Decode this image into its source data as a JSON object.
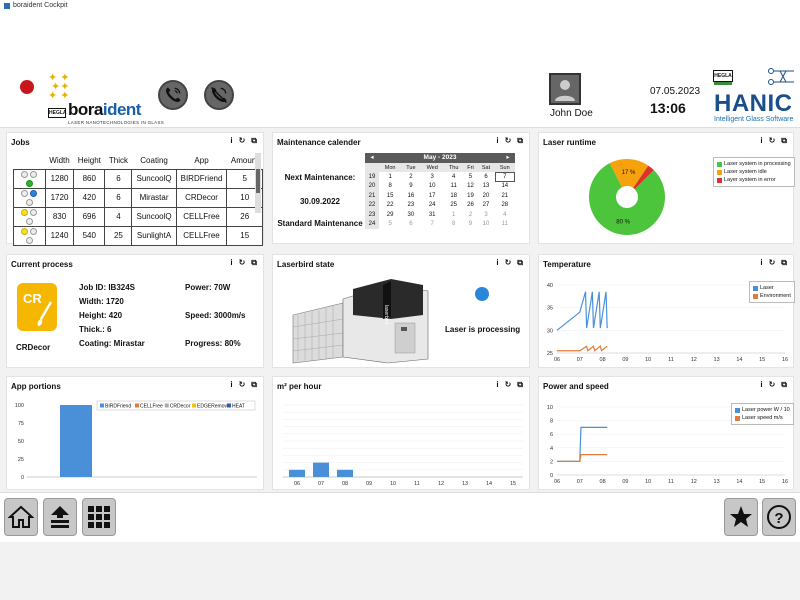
{
  "window": {
    "title": "boraident Cockpit"
  },
  "header": {
    "brand_left": "HEGLA",
    "brand_name_1": "bora",
    "brand_name_2": "ident",
    "brand_tagline": "LASER NANOTECHNOLOGIES IN GLASS",
    "user_name": "John Doe",
    "date": "07.05.2023",
    "time": "13:06",
    "brand_right_small": "HEGLA",
    "brand_right": "HANIC",
    "brand_right_tagline": "Intelligent Glass Software"
  },
  "panel_icons": {
    "info": "i",
    "refresh": "↻",
    "expand": "⧉"
  },
  "jobs": {
    "title": "Jobs",
    "columns": [
      "Width",
      "Height",
      "Thick",
      "Coating",
      "App",
      "Amount"
    ],
    "rows": [
      {
        "status": [
          "off",
          "off",
          "g"
        ],
        "width": "1280",
        "height": "860",
        "thick": "6",
        "coating": "SuncoolQ",
        "app": "BIRDFriend",
        "amount": "5"
      },
      {
        "status": [
          "off",
          "b",
          "off"
        ],
        "width": "1720",
        "height": "420",
        "thick": "6",
        "coating": "Mirastar",
        "app": "CRDecor",
        "amount": "10"
      },
      {
        "status": [
          "y",
          "off",
          "off"
        ],
        "width": "830",
        "height": "696",
        "thick": "4",
        "coating": "SuncoolQ",
        "app": "CELLFree",
        "amount": "26"
      },
      {
        "status": [
          "y",
          "off",
          "off"
        ],
        "width": "1240",
        "height": "540",
        "thick": "25",
        "coating": "SunlightA",
        "app": "CELLFree",
        "amount": "15"
      }
    ]
  },
  "maintenance": {
    "title": "Maintenance calender",
    "next_label": "Next Maintenance:",
    "next_date": "30.09.2022",
    "type": "Standard Maintenance",
    "calendar": {
      "month": "May - 2023",
      "prev": "◂",
      "next": "▸",
      "weekdays": [
        "Mon",
        "Tue",
        "Wed",
        "Thu",
        "Fri",
        "Sat",
        "Sun"
      ],
      "weeks": [
        {
          "wk": "19",
          "days": [
            "1",
            "2",
            "3",
            "4",
            "5",
            "6",
            "7"
          ]
        },
        {
          "wk": "20",
          "days": [
            "8",
            "9",
            "10",
            "11",
            "12",
            "13",
            "14"
          ]
        },
        {
          "wk": "21",
          "days": [
            "15",
            "16",
            "17",
            "18",
            "19",
            "20",
            "21"
          ]
        },
        {
          "wk": "22",
          "days": [
            "22",
            "23",
            "24",
            "25",
            "26",
            "27",
            "28"
          ]
        },
        {
          "wk": "23",
          "days": [
            "29",
            "30",
            "31",
            "1",
            "2",
            "3",
            "4"
          ]
        },
        {
          "wk": "24",
          "days": [
            "5",
            "6",
            "7",
            "8",
            "9",
            "10",
            "11"
          ]
        }
      ]
    }
  },
  "laser_runtime": {
    "title": "Laser runtime",
    "colors": {
      "processing": "#4cc43c",
      "idle": "#f5a20c",
      "error": "#d9342b"
    },
    "legend": [
      "Laser system in processing",
      "Laser system idle",
      "Layer system in error"
    ],
    "label_processing": "80 %",
    "label_idle": "17 %"
  },
  "current_process": {
    "title": "Current process",
    "icon_label": "CR",
    "app_name": "CRDecor",
    "job_id": "Job ID: IB324S",
    "width": "Width: 1720",
    "height": "Height: 420",
    "thick": "Thick.: 6",
    "coating": "Coating: Mirastar",
    "power": "Power: 70W",
    "speed": "Speed: 3000m/s",
    "progress": "Progress: 80%"
  },
  "laserbird": {
    "title": "Laserbird state",
    "machine_label": "laserbird",
    "status": "Laser is processing",
    "status_color": "#2a87d8"
  },
  "temperature": {
    "title": "Temperature",
    "legend": [
      "Laser",
      "Environment"
    ]
  },
  "app_portions": {
    "title": "App portions",
    "legend": [
      "BIRDFriend",
      "CELLFree",
      "CRDecor",
      "EDGERemove",
      "HEAT"
    ]
  },
  "m2_per_hour": {
    "title": "m² per hour"
  },
  "power_speed": {
    "title": "Power and speed",
    "legend": [
      "Laser power W / 10",
      "Laser speed m/s"
    ]
  },
  "chart_data": [
    {
      "type": "pie",
      "title": "Laser runtime",
      "categories": [
        "Laser system in processing",
        "Laser system idle",
        "Layer system in error"
      ],
      "values": [
        80,
        17,
        3
      ]
    },
    {
      "type": "line",
      "title": "Temperature",
      "xlim": [
        6,
        16
      ],
      "ylim": [
        25,
        40
      ],
      "x_ticks": [
        "06",
        "07",
        "08",
        "09",
        "10",
        "11",
        "12",
        "13",
        "14",
        "15",
        "16"
      ],
      "y_ticks": [
        "25",
        "30",
        "35",
        "40"
      ],
      "series": [
        {
          "name": "Laser",
          "color": "#4a90d9",
          "x": [
            6.0,
            7.0,
            7.25,
            7.3,
            7.55,
            7.6,
            7.85,
            7.9,
            8.15,
            8.2
          ],
          "y": [
            30.0,
            34.0,
            38.5,
            30.5,
            38.5,
            30.5,
            38.5,
            30.5,
            38.5,
            30.5
          ]
        },
        {
          "name": "Environment",
          "color": "#e07b39",
          "x": [
            6.0,
            7.0,
            7.3,
            7.35,
            7.6,
            7.65,
            7.9,
            7.95,
            8.2
          ],
          "y": [
            25.5,
            25.5,
            26.5,
            25.5,
            26.5,
            25.5,
            26.5,
            25.5,
            26.5
          ]
        }
      ]
    },
    {
      "type": "bar",
      "title": "App portions",
      "ylim": [
        0,
        100
      ],
      "y_ticks": [
        "0",
        "25",
        "50",
        "75",
        "100"
      ],
      "series": [
        {
          "name": "BIRDFriend",
          "color": "#4a90d9",
          "values": [
            100
          ]
        },
        {
          "name": "CELLFree",
          "color": "#e07b39",
          "values": [
            0
          ]
        },
        {
          "name": "CRDecor",
          "color": "#aaaaaa",
          "values": [
            0
          ]
        },
        {
          "name": "EDGERemove",
          "color": "#f5c400",
          "values": [
            0
          ]
        },
        {
          "name": "HEAT",
          "color": "#2a5fa8",
          "values": [
            0
          ]
        }
      ]
    },
    {
      "type": "bar",
      "title": "m² per hour",
      "categories": [
        "06",
        "07",
        "08",
        "09",
        "10",
        "11",
        "12",
        "13",
        "14",
        "15"
      ],
      "values": [
        1,
        2,
        1,
        0,
        0,
        0,
        0,
        0,
        0,
        0
      ],
      "ylim": [
        0,
        10
      ],
      "color": "#4a90d9"
    },
    {
      "type": "line",
      "title": "Power and speed",
      "xlim": [
        6,
        16
      ],
      "ylim": [
        0,
        10
      ],
      "x_ticks": [
        "06",
        "07",
        "08",
        "09",
        "10",
        "11",
        "12",
        "13",
        "14",
        "15",
        "16"
      ],
      "y_ticks": [
        "0",
        "2",
        "4",
        "6",
        "8",
        "10"
      ],
      "series": [
        {
          "name": "Laser power W / 10",
          "color": "#4a90d9",
          "x": [
            6.0,
            7.0,
            7.05,
            8.2
          ],
          "y": [
            2.0,
            2.0,
            7.0,
            7.0
          ]
        },
        {
          "name": "Laser speed m/s",
          "color": "#e07b39",
          "x": [
            6.0,
            7.0,
            7.05,
            8.2
          ],
          "y": [
            2.0,
            2.0,
            3.0,
            3.0
          ]
        }
      ]
    }
  ]
}
